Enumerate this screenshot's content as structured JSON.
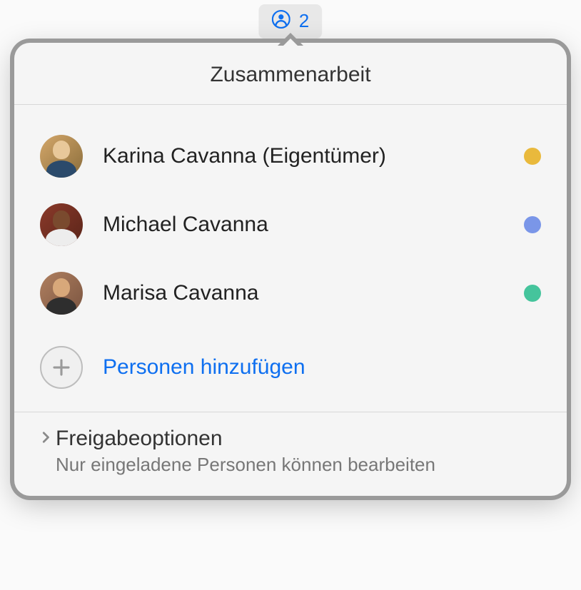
{
  "badge": {
    "count": "2",
    "accent_color": "#0e6ff0"
  },
  "popover": {
    "title": "Zusammenarbeit",
    "participants": [
      {
        "name": "Karina Cavanna (Eigentümer)",
        "presence_color": "#e9b93c"
      },
      {
        "name": "Michael Cavanna",
        "presence_color": "#7a96e8"
      },
      {
        "name": "Marisa Cavanna",
        "presence_color": "#45c49c"
      }
    ],
    "add_people_label": "Personen hinzufügen",
    "share_options": {
      "title": "Freigabeoptionen",
      "description": "Nur eingeladene Personen können bearbeiten"
    }
  }
}
